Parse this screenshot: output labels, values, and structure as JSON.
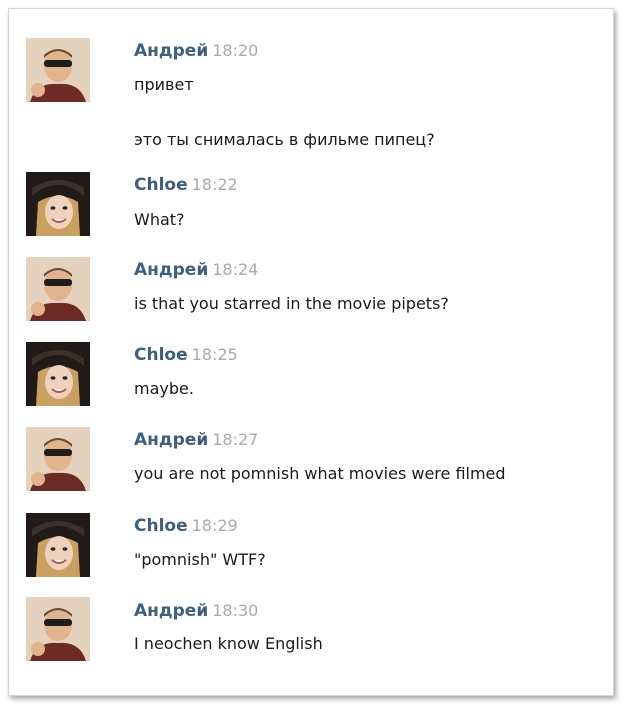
{
  "messages": [
    {
      "author": "Андрей",
      "time": "18:20",
      "avatar": "andrey-avatar-photo",
      "lines": [
        "привет",
        "это ты снималась в фильме пипец?"
      ]
    },
    {
      "author": "Chloe",
      "time": "18:22",
      "avatar": "chloe-avatar-photo",
      "lines": [
        "What?"
      ]
    },
    {
      "author": "Андрей",
      "time": "18:24",
      "avatar": "andrey-avatar-photo",
      "lines": [
        "is that you starred in the movie pipets?"
      ]
    },
    {
      "author": "Chloe",
      "time": "18:25",
      "avatar": "chloe-avatar-photo",
      "lines": [
        "maybe."
      ]
    },
    {
      "author": "Андрей",
      "time": "18:27",
      "avatar": "andrey-avatar-photo",
      "lines": [
        "you are not pomnish what movies were filmed"
      ]
    },
    {
      "author": "Chloe",
      "time": "18:29",
      "avatar": "chloe-avatar-photo",
      "lines": [
        "\"pomnish\" WTF?"
      ]
    },
    {
      "author": "Андрей",
      "time": "18:30",
      "avatar": "andrey-avatar-photo",
      "lines": [
        "I neochen know English"
      ]
    }
  ],
  "colors": {
    "author": "#3f5f7f",
    "time": "#a9a9a9",
    "text": "#1a1a1a",
    "border": "#d4d4d4"
  }
}
